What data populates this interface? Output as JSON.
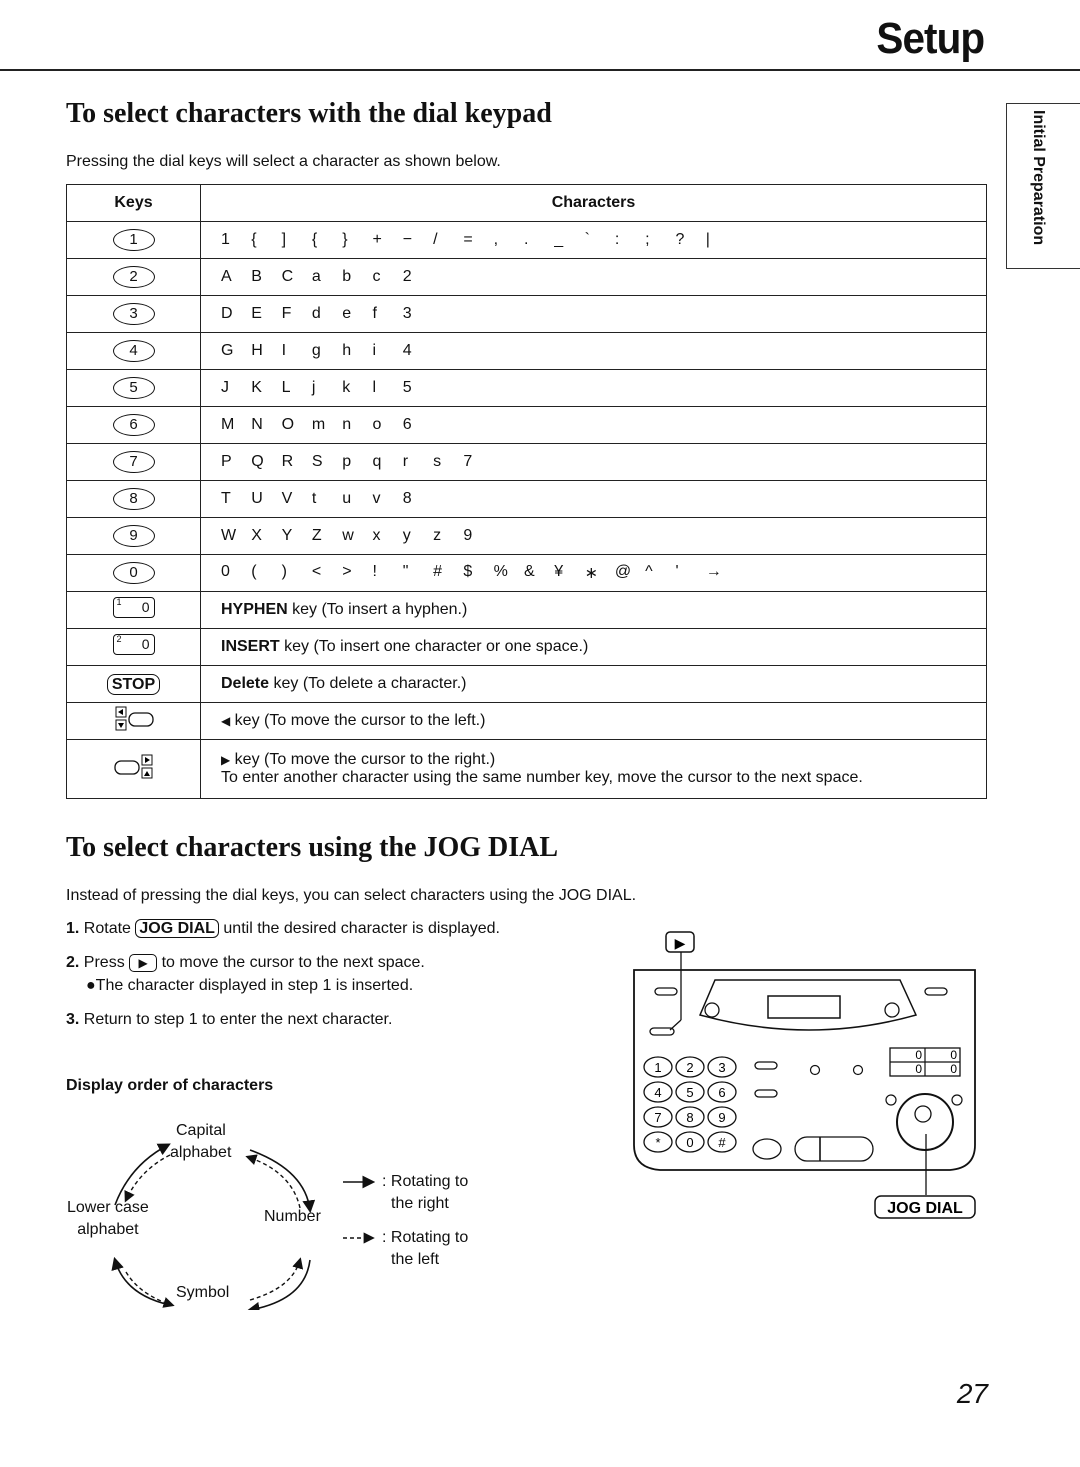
{
  "header": {
    "section": "Setup"
  },
  "side_tab": {
    "label": "Initial Preparation"
  },
  "section1": {
    "title": "To select characters with the dial keypad",
    "intro": "Pressing the dial keys will select a character as shown below.",
    "table": {
      "headers": {
        "keys": "Keys",
        "characters": "Characters"
      },
      "dial_rows": [
        {
          "key": "1",
          "chars": [
            "1",
            "{",
            "]",
            "{",
            "}",
            "+",
            "−",
            "/",
            "=",
            ",",
            ".",
            "_",
            "`",
            ":",
            ";",
            "?",
            "|"
          ]
        },
        {
          "key": "2",
          "chars": [
            "A",
            "B",
            "C",
            "a",
            "b",
            "c",
            "2"
          ]
        },
        {
          "key": "3",
          "chars": [
            "D",
            "E",
            "F",
            "d",
            "e",
            "f",
            "3"
          ]
        },
        {
          "key": "4",
          "chars": [
            "G",
            "H",
            "I",
            "g",
            "h",
            "i",
            "4"
          ]
        },
        {
          "key": "5",
          "chars": [
            "J",
            "K",
            "L",
            "j",
            "k",
            "l",
            "5"
          ]
        },
        {
          "key": "6",
          "chars": [
            "M",
            "N",
            "O",
            "m",
            "n",
            "o",
            "6"
          ]
        },
        {
          "key": "7",
          "chars": [
            "P",
            "Q",
            "R",
            "S",
            "p",
            "q",
            "r",
            "s",
            "7"
          ]
        },
        {
          "key": "8",
          "chars": [
            "T",
            "U",
            "V",
            "t",
            "u",
            "v",
            "8"
          ]
        },
        {
          "key": "9",
          "chars": [
            "W",
            "X",
            "Y",
            "Z",
            "w",
            "x",
            "y",
            "z",
            "9"
          ]
        },
        {
          "key": "0",
          "chars": [
            "0",
            "(",
            ")",
            "<",
            ">",
            "!",
            "\"",
            "#",
            "$",
            "%",
            "&",
            "¥",
            "∗",
            "@",
            "^",
            "'",
            "→"
          ]
        }
      ],
      "function_rows": [
        {
          "key_icon": "hyphen-key-icon",
          "key_sup": "1",
          "key_label": "0",
          "bold": "HYPHEN",
          "text": " key (To insert a hyphen.)"
        },
        {
          "key_icon": "insert-key-icon",
          "key_sup": "2",
          "key_label": "0",
          "bold": "INSERT",
          "text": " key (To insert one character or one space.)"
        },
        {
          "key_icon": "stop-key-icon",
          "key_label": "STOP",
          "bold": "Delete",
          "text": " key (To delete a character.)"
        },
        {
          "key_icon": "left-cursor-key-icon",
          "arrow": "◀",
          "text": " key (To move the cursor to the left.)"
        },
        {
          "key_icon": "right-cursor-key-icon",
          "arrow": "▶",
          "text": " key (To move the cursor to the right.)",
          "note": "To enter another character using the same number key, move the cursor to the next space."
        }
      ]
    }
  },
  "section2": {
    "title": "To select characters using the JOG DIAL",
    "intro": "Instead of pressing the dial keys, you can select characters using the JOG DIAL.",
    "steps": [
      {
        "num": "1.",
        "pre": "Rotate ",
        "key": "JOG DIAL",
        "post": " until the desired character is displayed."
      },
      {
        "num": "2.",
        "pre": "Press ",
        "key": "▶",
        "post": " to move the cursor to the next space.",
        "bullet": "●The character displayed in step 1 is inserted."
      },
      {
        "num": "3.",
        "pre": "Return to step 1 to enter the next character."
      }
    ],
    "display_order": {
      "heading": "Display order of characters",
      "nodes": [
        "Capital alphabet",
        "Number",
        "Symbol",
        "Lower case alphabet"
      ],
      "node_lines": {
        "capital": [
          "Capital",
          "alphabet"
        ],
        "number": [
          "Number"
        ],
        "symbol": [
          "Symbol"
        ],
        "lower": [
          "Lower case",
          "alphabet"
        ]
      },
      "legend": [
        {
          "style": "solid",
          "label_lines": [
            ": Rotating to",
            "the right"
          ]
        },
        {
          "style": "dashed",
          "label_lines": [
            ": Rotating to",
            "the left"
          ]
        }
      ]
    },
    "device": {
      "callout_top": "▶",
      "callout_bottom": "JOG DIAL",
      "keypad": [
        "1",
        "2",
        "3",
        "4",
        "5",
        "6",
        "7",
        "8",
        "9",
        "*",
        "0",
        "#"
      ],
      "counter": [
        "0",
        "0",
        "0",
        "0"
      ]
    }
  },
  "footer": {
    "page_number": "27"
  }
}
